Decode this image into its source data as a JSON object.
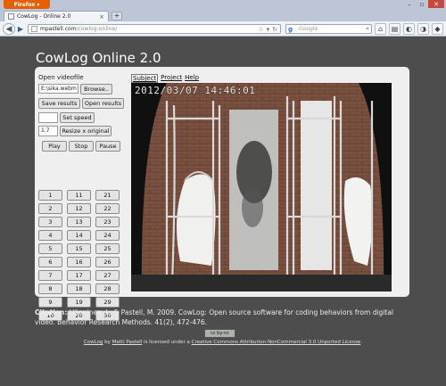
{
  "browser": {
    "app_button": "Firefox",
    "tab_title": "CowLog - Online 2.0",
    "url_host": "mpastell.com",
    "url_path": "/cowlog-online/",
    "search_engine_letter": "g",
    "search_placeholder": "Google"
  },
  "app": {
    "title": "CowLog Online 2.0",
    "open_label": "Open videofile",
    "file_value": "E:\\sika.webm",
    "browse_label": "Browse..",
    "save_results": "Save results",
    "open_results": "Open results",
    "speed_value": "",
    "set_speed": "Set speed",
    "resize_value": "1.7",
    "resize_label": "Resize x original",
    "play": "Play",
    "stop": "Stop",
    "pause": "Pause",
    "codes": [
      [
        "1",
        "11",
        "21"
      ],
      [
        "2",
        "12",
        "22"
      ],
      [
        "3",
        "13",
        "23"
      ],
      [
        "4",
        "14",
        "24"
      ],
      [
        "5",
        "15",
        "25"
      ],
      [
        "6",
        "16",
        "26"
      ],
      [
        "7",
        "17",
        "27"
      ],
      [
        "8",
        "18",
        "28"
      ],
      [
        "9",
        "19",
        "29"
      ],
      [
        "10",
        "20",
        "30"
      ]
    ],
    "menu": {
      "subject": "Subject",
      "project": "Project",
      "help": "Help"
    },
    "video_timestamp": "2012/03/07 14:46:01"
  },
  "footer": {
    "citation_label": "Citation:",
    "citation_text": " Hänninen, L. & Pastell, M. 2009. CowLog: Open source software for coding behaviors from digital video. Behavior Research Methods. 41(2), 472-476.",
    "cc_badge": "cc by-nc",
    "license_app": "CowLog",
    "license_by": " by ",
    "license_author": "Matti Pastell",
    "license_mid": " is licensed under a ",
    "license_name": "Creative Commons Attribution-NonCommercial 3.0 Unported License",
    "license_end": "."
  }
}
